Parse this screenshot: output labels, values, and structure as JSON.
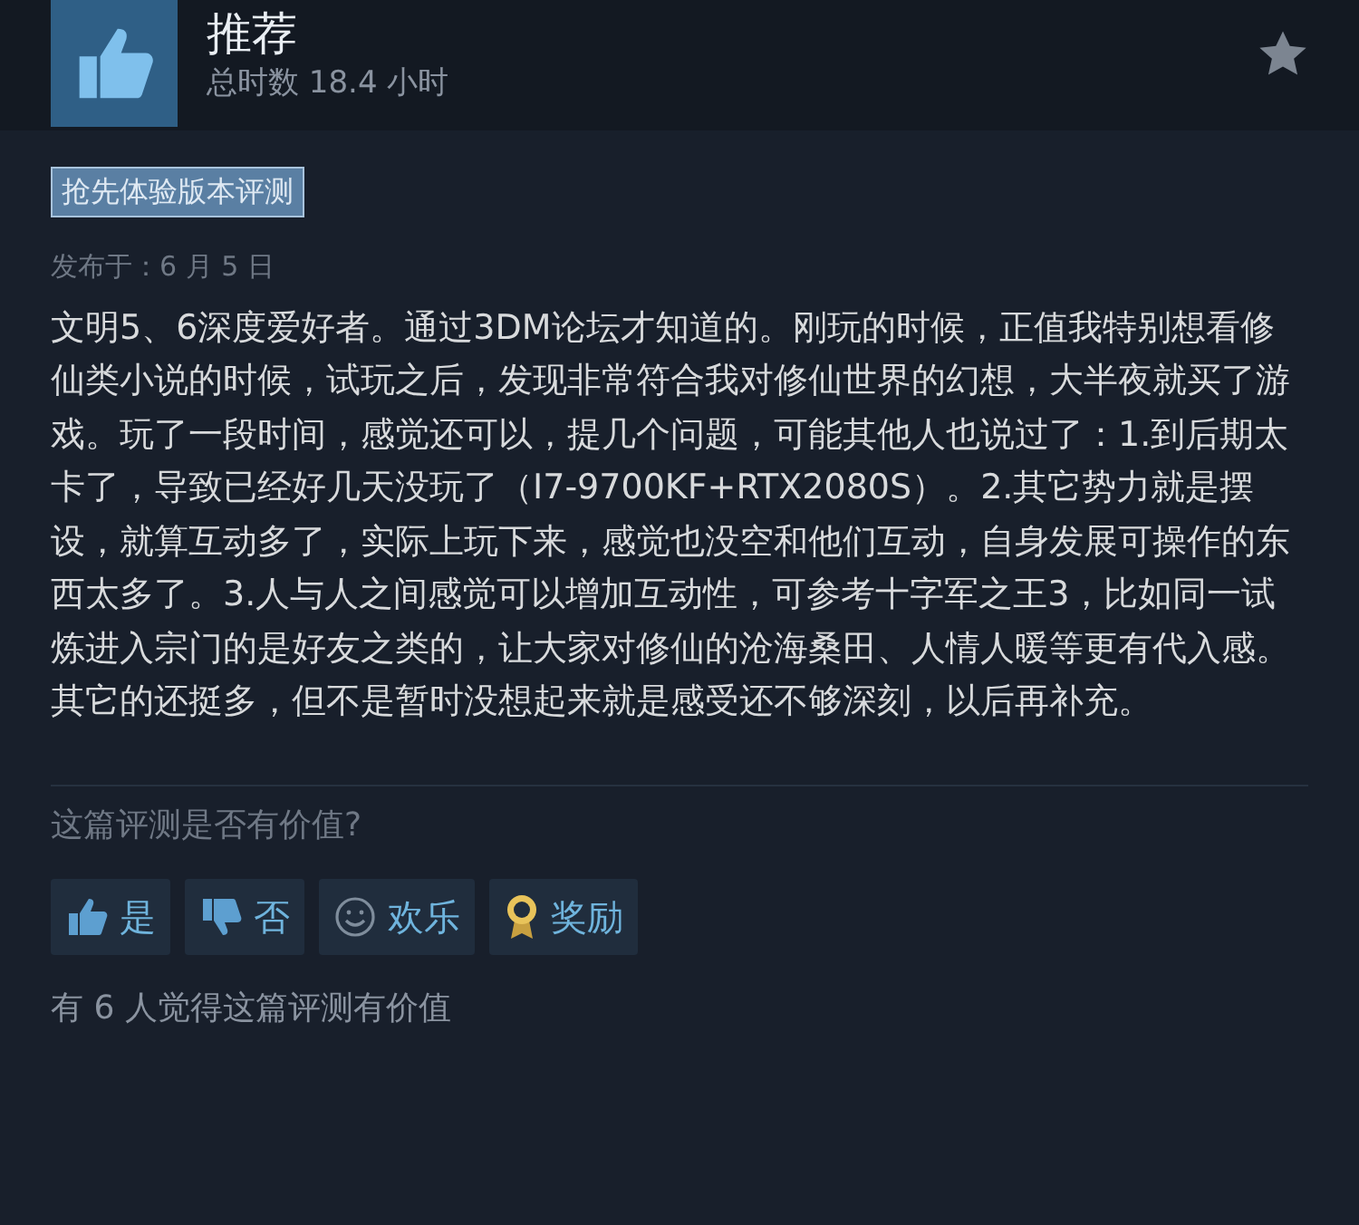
{
  "header": {
    "verdict": "推荐",
    "playtime": "总时数 18.4 小时"
  },
  "tag": "抢先体验版本评测",
  "posted": "发布于：6 月 5 日",
  "review_text": "文明5、6深度爱好者。通过3DM论坛才知道的。刚玩的时候，正值我特别想看修仙类小说的时候，试玩之后，发现非常符合我对修仙世界的幻想，大半夜就买了游戏。玩了一段时间，感觉还可以，提几个问题，可能其他人也说过了：1.到后期太卡了，导致已经好几天没玩了（I7-9700KF+RTX2080S）。2.其它势力就是摆设，就算互动多了，实际上玩下来，感觉也没空和他们互动，自身发展可操作的东西太多了。3.人与人之间感觉可以增加互动性，可参考十字军之王3，比如同一试炼进入宗门的是好友之类的，让大家对修仙的沧海桑田、人情人暖等更有代入感。其它的还挺多，但不是暂时没想起来就是感受还不够深刻，以后再补充。",
  "helpful_question": "这篇评测是否有价值?",
  "buttons": [
    {
      "kind": "up",
      "label": "是"
    },
    {
      "kind": "down",
      "label": "否"
    },
    {
      "kind": "funny",
      "label": "欢乐"
    },
    {
      "kind": "award",
      "label": "奖励"
    }
  ],
  "helpful_count": "有 6 人觉得这篇评测有价值"
}
